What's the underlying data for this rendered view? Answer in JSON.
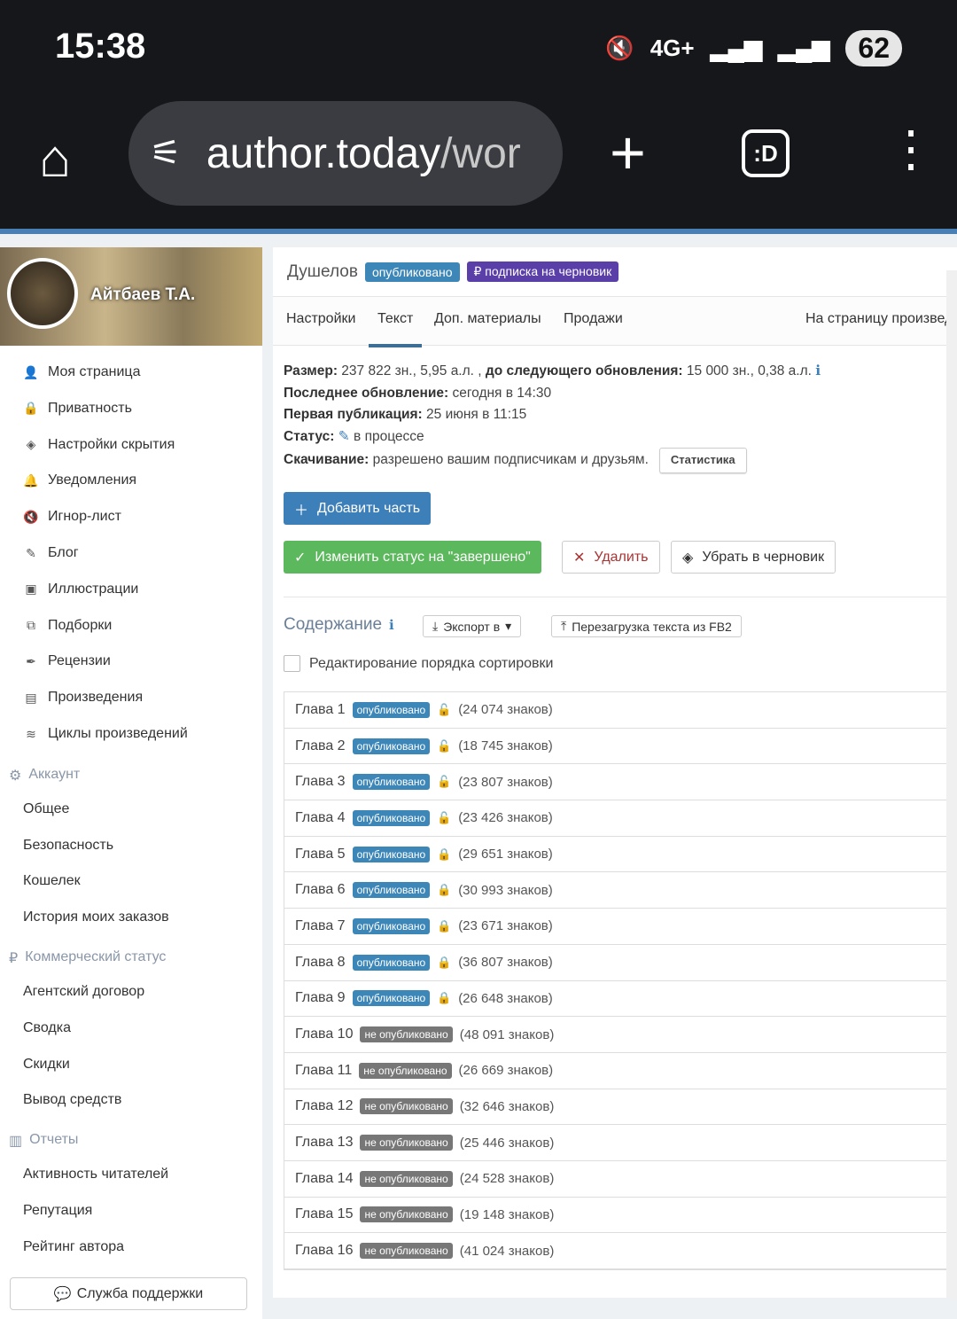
{
  "status_bar": {
    "time": "15:38",
    "network": "4G+",
    "battery": "62"
  },
  "browser": {
    "url_host": "author.today",
    "url_path": "/wor"
  },
  "sidebar": {
    "user_name": "Айтбаев Т.А.",
    "items": [
      {
        "label": "Моя страница",
        "icon": "user-icon",
        "glyph": "👤"
      },
      {
        "label": "Приватность",
        "icon": "lock-icon",
        "glyph": "🔒"
      },
      {
        "label": "Настройки скрытия",
        "icon": "eye-slash-icon",
        "glyph": "◈"
      },
      {
        "label": "Уведомления",
        "icon": "bell-icon",
        "glyph": "🔔"
      },
      {
        "label": "Игнор-лист",
        "icon": "mute-icon",
        "glyph": "🔇"
      },
      {
        "label": "Блог",
        "icon": "blog-icon",
        "glyph": "✎"
      },
      {
        "label": "Иллюстрации",
        "icon": "image-icon",
        "glyph": "▣"
      },
      {
        "label": "Подборки",
        "icon": "collection-icon",
        "glyph": "⧉"
      },
      {
        "label": "Рецензии",
        "icon": "quill-icon",
        "glyph": "✒"
      },
      {
        "label": "Произведения",
        "icon": "book-icon",
        "glyph": "▤"
      },
      {
        "label": "Циклы произведений",
        "icon": "stack-icon",
        "glyph": "≋"
      }
    ],
    "sections": [
      {
        "title": "Аккаунт",
        "icon": "gears-icon",
        "glyph": "⚙",
        "items": [
          "Общее",
          "Безопасность",
          "Кошелек",
          "История моих заказов"
        ]
      },
      {
        "title": "Коммерческий статус",
        "icon": "ruble-icon",
        "glyph": "₽",
        "items": [
          "Агентский договор",
          "Сводка",
          "Скидки",
          "Вывод средств"
        ]
      },
      {
        "title": "Отчеты",
        "icon": "bar-chart-icon",
        "glyph": "▥",
        "items": [
          "Активность читателей",
          "Репутация",
          "Рейтинг автора"
        ]
      }
    ],
    "support": "Служба поддержки"
  },
  "work": {
    "title": "Душелов",
    "badge_published": "опубликовано",
    "badge_subscription": "₽ подписка на черновик",
    "colors": {
      "published": "#3d86b8",
      "subscription": "#5b3fa8",
      "green": "#5cb85c"
    },
    "tabs": [
      "Настройки",
      "Текст",
      "Доп. материалы",
      "Продажи"
    ],
    "tab_link": "На страницу произвед",
    "info": {
      "size_label": "Размер:",
      "size_value": "237 822 зн., 5,95 а.л. ,",
      "next_label": "до следующего обновления:",
      "next_value": "15 000 зн., 0,38 а.л.",
      "updated_label": "Последнее обновление:",
      "updated_value": "сегодня в 14:30",
      "first_label": "Первая публикация:",
      "first_value": "25 июня в 11:15",
      "status_label": "Статус:",
      "status_value": "в процессе",
      "download_label": "Скачивание:",
      "download_value": "разрешено вашим подписчикам и друзьям.",
      "stats_button": "Статистика"
    },
    "buttons": {
      "add_part": "Добавить часть",
      "complete": "Изменить статус на \"завершено\"",
      "delete": "Удалить",
      "to_draft": "Убрать в черновик"
    },
    "toc": {
      "title": "Содержание",
      "export": "Экспорт в",
      "reload": "Перезагрузка текста из FB2",
      "sort_label": "Редактирование порядка сортировки"
    },
    "chapters": [
      {
        "name": "Глава 1",
        "status": "опубликовано",
        "pub": true,
        "locked": false,
        "count": "(24 074 знаков)"
      },
      {
        "name": "Глава 2",
        "status": "опубликовано",
        "pub": true,
        "locked": false,
        "count": "(18 745 знаков)"
      },
      {
        "name": "Глава 3",
        "status": "опубликовано",
        "pub": true,
        "locked": false,
        "count": "(23 807 знаков)"
      },
      {
        "name": "Глава 4",
        "status": "опубликовано",
        "pub": true,
        "locked": false,
        "count": "(23 426 знаков)"
      },
      {
        "name": "Глава 5",
        "status": "опубликовано",
        "pub": true,
        "locked": true,
        "count": "(29 651 знаков)"
      },
      {
        "name": "Глава 6",
        "status": "опубликовано",
        "pub": true,
        "locked": true,
        "count": "(30 993 знаков)"
      },
      {
        "name": "Глава 7",
        "status": "опубликовано",
        "pub": true,
        "locked": true,
        "count": "(23 671 знаков)"
      },
      {
        "name": "Глава 8",
        "status": "опубликовано",
        "pub": true,
        "locked": true,
        "count": "(36 807 знаков)"
      },
      {
        "name": "Глава 9",
        "status": "опубликовано",
        "pub": true,
        "locked": true,
        "count": "(26 648 знаков)"
      },
      {
        "name": "Глава 10",
        "status": "не опубликовано",
        "pub": false,
        "count": "(48 091 знаков)"
      },
      {
        "name": "Глава 11",
        "status": "не опубликовано",
        "pub": false,
        "count": "(26 669 знаков)"
      },
      {
        "name": "Глава 12",
        "status": "не опубликовано",
        "pub": false,
        "count": "(32 646 знаков)"
      },
      {
        "name": "Глава 13",
        "status": "не опубликовано",
        "pub": false,
        "count": "(25 446 знаков)"
      },
      {
        "name": "Глава 14",
        "status": "не опубликовано",
        "pub": false,
        "count": "(24 528 знаков)"
      },
      {
        "name": "Глава 15",
        "status": "не опубликовано",
        "pub": false,
        "count": "(19 148 знаков)"
      },
      {
        "name": "Глава 16",
        "status": "не опубликовано",
        "pub": false,
        "count": "(41 024 знаков)"
      }
    ]
  }
}
